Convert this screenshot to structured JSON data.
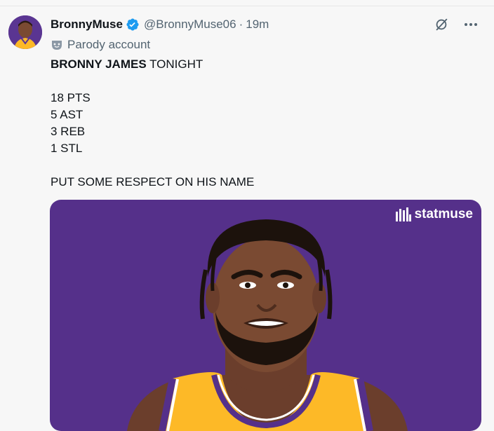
{
  "tweet": {
    "display_name": "BronnyMuse",
    "handle": "@BronnyMuse06",
    "separator": "·",
    "time": "19m",
    "label": "Parody account",
    "text_line1_bold": "BRONNY JAMES",
    "text_line1_rest": " TONIGHT",
    "stats": [
      "18 PTS",
      "5 AST",
      "3 REB",
      "1 STL"
    ],
    "closing": "PUT SOME RESPECT ON HIS NAME"
  },
  "media": {
    "watermark": "statmuse"
  },
  "colors": {
    "background": "#f7f7f7",
    "verified": "#1d9bf0",
    "media_bg": "#55308a",
    "jersey": "#fdb927"
  },
  "icons": [
    "verified-badge-icon",
    "grok-icon",
    "more-icon",
    "parody-mask-icon",
    "statmuse-logo-icon"
  ]
}
